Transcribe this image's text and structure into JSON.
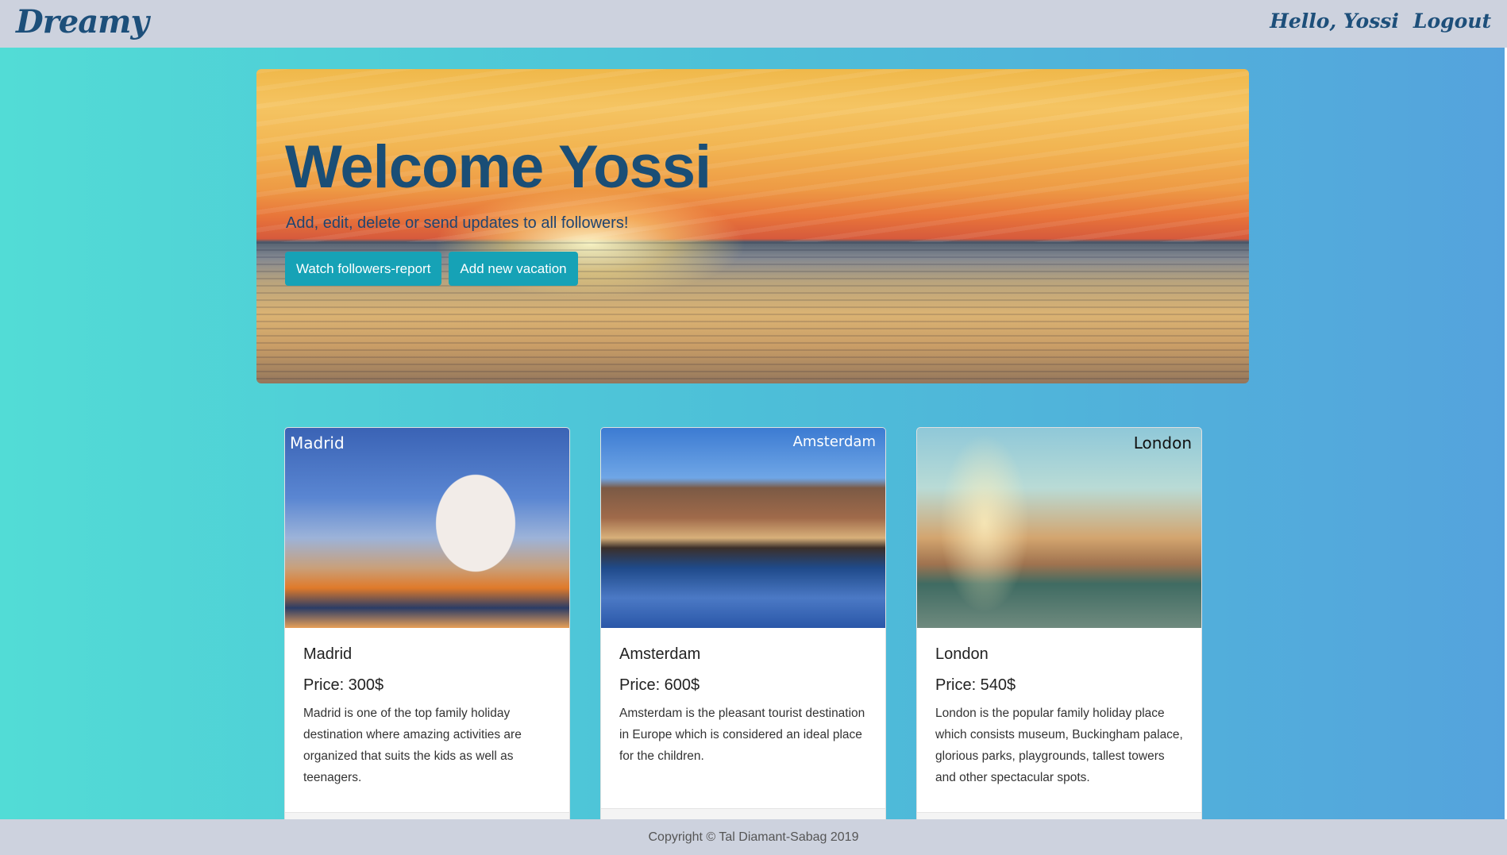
{
  "navbar": {
    "brand": "Dreamy",
    "greeting": "Hello, Yossi",
    "logout": "Logout"
  },
  "hero": {
    "title": "Welcome Yossi",
    "subtitle": "Add, edit, delete or send updates to all followers!",
    "buttons": {
      "report": "Watch followers-report",
      "add": "Add new vacation"
    }
  },
  "vacations": [
    {
      "image_label": "Madrid",
      "name": "Madrid",
      "price": "Price: 300$",
      "description": "Madrid is one of the top family holiday destination where amazing activities are organized that suits the kids as well as teenagers."
    },
    {
      "image_label": "Amsterdam",
      "name": "Amsterdam",
      "price": "Price: 600$",
      "description": "Amsterdam is the pleasant tourist destination in Europe which is considered an ideal place for the children."
    },
    {
      "image_label": "London",
      "name": "London",
      "price": "Price: 540$",
      "description": "London is the popular family holiday place which consists museum, Buckingham palace, glorious parks, playgrounds, tallest towers and other spectacular spots."
    }
  ],
  "footer": {
    "copyright": "Copyright © Tal Diamant-Sabag 2019"
  },
  "colors": {
    "navbar_bg": "#cdd2de",
    "brand": "#1d4f7a",
    "button": "#16a2b6",
    "background_start": "#52dcd6",
    "background_end": "#55a3dd"
  }
}
